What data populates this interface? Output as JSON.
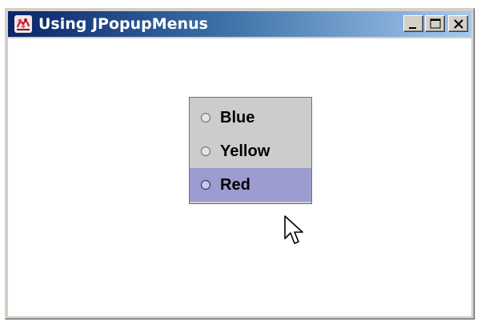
{
  "window": {
    "title": "Using JPopupMenus",
    "icon": "java-app-icon",
    "controls": {
      "minimize_icon": "minimize-icon",
      "maximize_icon": "maximize-icon",
      "close_icon": "close-icon"
    }
  },
  "popup_menu": {
    "items": [
      {
        "label": "Blue",
        "type": "radio",
        "checked": false,
        "highlighted": false
      },
      {
        "label": "Yellow",
        "type": "radio",
        "checked": false,
        "highlighted": false
      },
      {
        "label": "Red",
        "type": "radio",
        "checked": false,
        "highlighted": true
      }
    ]
  },
  "colors": {
    "title_gradient_start": "#0a246a",
    "title_gradient_end": "#a6caf0",
    "menu_background": "#cccccc",
    "menu_highlight": "#9c9cd0",
    "client_background": "#ffffff"
  },
  "cursor": {
    "icon": "arrow-pointer-icon"
  }
}
